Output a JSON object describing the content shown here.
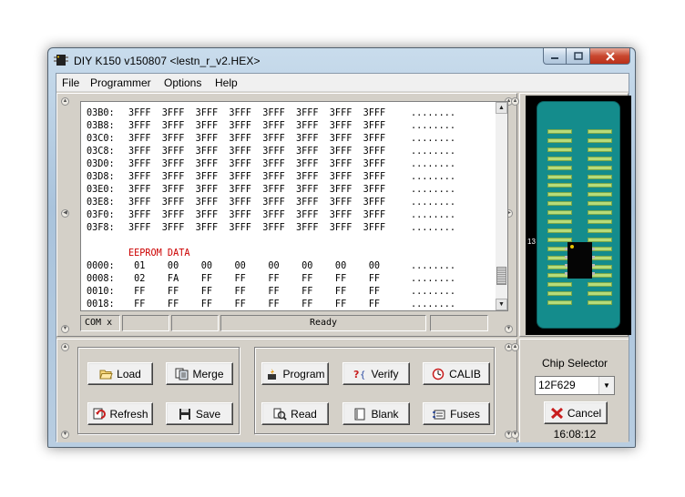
{
  "window": {
    "title": "DIY K150 v150807  <lestn_r_v2.HEX>"
  },
  "menu": [
    "File",
    "Programmer",
    "Options",
    "Help"
  ],
  "hex": {
    "rows": [
      {
        "addr": "03B0:",
        "data": "3FFF  3FFF  3FFF  3FFF  3FFF  3FFF  3FFF  3FFF",
        "ascii": "........"
      },
      {
        "addr": "03B8:",
        "data": "3FFF  3FFF  3FFF  3FFF  3FFF  3FFF  3FFF  3FFF",
        "ascii": "........"
      },
      {
        "addr": "03C0:",
        "data": "3FFF  3FFF  3FFF  3FFF  3FFF  3FFF  3FFF  3FFF",
        "ascii": "........"
      },
      {
        "addr": "03C8:",
        "data": "3FFF  3FFF  3FFF  3FFF  3FFF  3FFF  3FFF  3FFF",
        "ascii": "........"
      },
      {
        "addr": "03D0:",
        "data": "3FFF  3FFF  3FFF  3FFF  3FFF  3FFF  3FFF  3FFF",
        "ascii": "........"
      },
      {
        "addr": "03D8:",
        "data": "3FFF  3FFF  3FFF  3FFF  3FFF  3FFF  3FFF  3FFF",
        "ascii": "........"
      },
      {
        "addr": "03E0:",
        "data": "3FFF  3FFF  3FFF  3FFF  3FFF  3FFF  3FFF  3FFF",
        "ascii": "........"
      },
      {
        "addr": "03E8:",
        "data": "3FFF  3FFF  3FFF  3FFF  3FFF  3FFF  3FFF  3FFF",
        "ascii": "........"
      },
      {
        "addr": "03F0:",
        "data": "3FFF  3FFF  3FFF  3FFF  3FFF  3FFF  3FFF  3FFF",
        "ascii": "........"
      },
      {
        "addr": "03F8:",
        "data": "3FFF  3FFF  3FFF  3FFF  3FFF  3FFF  3FFF  3FFF",
        "ascii": "........"
      }
    ],
    "eeprom_title": "EEPROM DATA",
    "eeprom_rows": [
      {
        "addr": "0000:",
        "data": " 01    00    00    00    00    00    00    00",
        "ascii": "........"
      },
      {
        "addr": "0008:",
        "data": " 02    FA    FF    FF    FF    FF    FF    FF",
        "ascii": "........"
      },
      {
        "addr": "0010:",
        "data": " FF    FF    FF    FF    FF    FF    FF    FF",
        "ascii": "........"
      },
      {
        "addr": "0018:",
        "data": " FF    FF    FF    FF    FF    FF    FF    FF",
        "ascii": "........"
      }
    ]
  },
  "status": {
    "port": "COM x",
    "message": "Ready"
  },
  "socket": {
    "pin_marker": "13"
  },
  "buttons": {
    "load": "Load",
    "merge": "Merge",
    "refresh": "Refresh",
    "save": "Save",
    "program": "Program",
    "verify": "Verify",
    "calib": "CALIB",
    "read": "Read",
    "blank": "Blank",
    "fuses": "Fuses",
    "cancel": "Cancel"
  },
  "chip_selector": {
    "label": "Chip Selector",
    "value": "12F629"
  },
  "clock": "16:08:12",
  "icons": {
    "load": "folder-open-icon",
    "merge": "document-merge-icon",
    "refresh": "refresh-icon",
    "save": "floppy-disk-icon",
    "program": "program-chip-icon",
    "verify": "verify-icon",
    "calib": "calibrate-icon",
    "read": "read-icon",
    "blank": "blank-check-icon",
    "fuses": "fuses-icon",
    "cancel": "cancel-x-icon"
  },
  "colors": {
    "socket": "#148c8c",
    "eeprom_title": "#cc0000",
    "cancel_icon": "#c81e1e"
  }
}
